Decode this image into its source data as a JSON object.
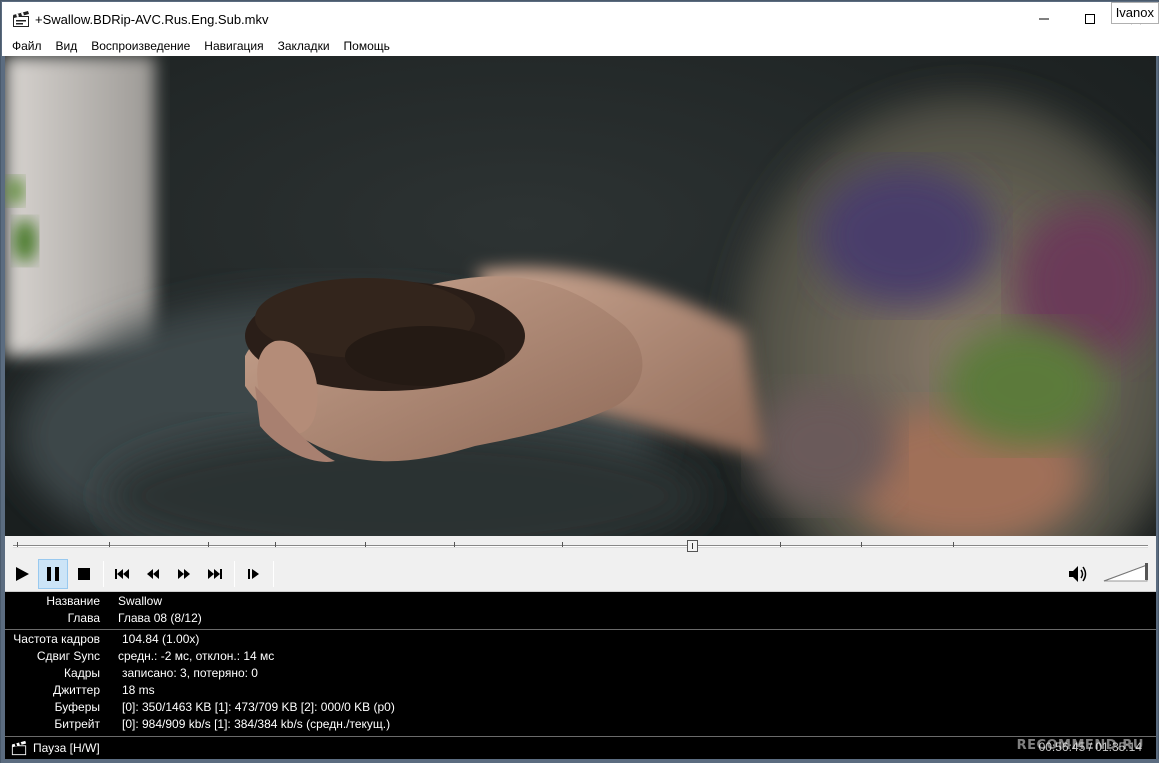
{
  "window": {
    "title": "+Swallow.BDRip-AVC.Rus.Eng.Sub.mkv",
    "user_badge": "Ivanox",
    "controls": {
      "minimize": "—",
      "maximize": "☐",
      "close": "✕"
    }
  },
  "menu": {
    "items": [
      {
        "label": "Файл"
      },
      {
        "label": "Вид"
      },
      {
        "label": "Воспроизведение"
      },
      {
        "label": "Навигация"
      },
      {
        "label": "Закладки"
      },
      {
        "label": "Помощь"
      }
    ]
  },
  "seek": {
    "position_fraction": 0.598
  },
  "toolbar": {
    "buttons": [
      {
        "name": "play",
        "icon": "play-icon"
      },
      {
        "name": "pause",
        "icon": "pause-icon",
        "active": true
      },
      {
        "name": "stop",
        "icon": "stop-icon"
      },
      {
        "name": "prev-chapter",
        "icon": "skip-back-icon"
      },
      {
        "name": "rewind",
        "icon": "rewind-icon"
      },
      {
        "name": "fast-forward",
        "icon": "fast-forward-icon"
      },
      {
        "name": "next-chapter",
        "icon": "skip-forward-icon"
      },
      {
        "name": "frame-step",
        "icon": "frame-step-icon"
      }
    ],
    "volume_icon": "speaker-icon",
    "volume_level": 1.0
  },
  "info": {
    "title": {
      "label": "Название",
      "value": "Swallow"
    },
    "chapter": {
      "label": "Глава",
      "value": "Глава 08 (8/12)"
    },
    "framerate": {
      "label": "Частота кадров",
      "value": "104.84 (1.00x)"
    },
    "sync": {
      "label": "Сдвиг Sync",
      "value": "средн.: -2 мс, отклон.: 14 мс"
    },
    "frames": {
      "label": "Кадры",
      "value": "записано: 3, потеряно: 0"
    },
    "jitter": {
      "label": "Джиттер",
      "value": "18 ms"
    },
    "buffers": {
      "label": "Буферы",
      "value": "[0]: 350/1463 KB [1]: 473/709 KB [2]: 000/0 KB (p0)"
    },
    "bitrate": {
      "label": "Битрейт",
      "value": "[0]: 984/909 kb/s [1]: 384/384 kb/s (средн./текущ.)"
    }
  },
  "status": {
    "text": "Пауза [H/W]",
    "time": "00:56:45 / 01:35:14",
    "watermark": "RECOMMEND.RU"
  },
  "colors": {
    "frame": "#5b6c80",
    "panel_bg": "#000000",
    "toolbar_bg": "#f0f0f0",
    "active_button": "#cce4f7"
  }
}
